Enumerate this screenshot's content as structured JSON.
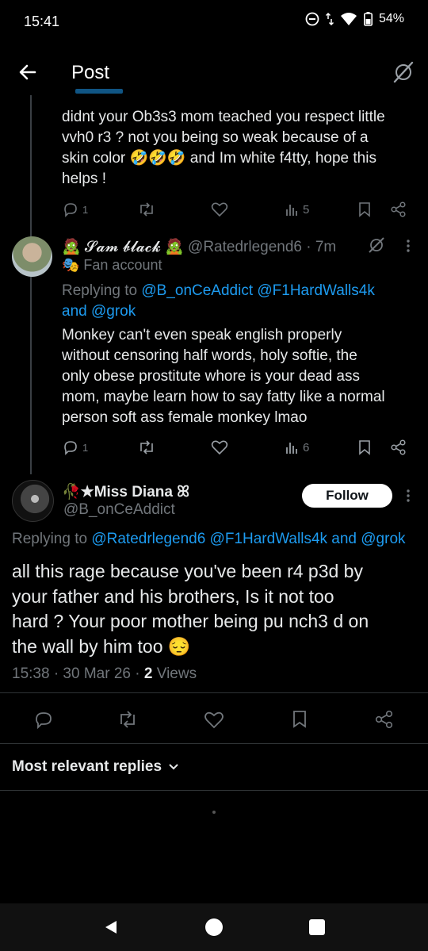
{
  "status": {
    "time": "15:41",
    "battery": "54%"
  },
  "header": {
    "title": "Post"
  },
  "tweet_top": {
    "text_lines": [
      "didnt your Ob3s3 mom teached you respect little",
      "vvh0 r3 ? not you being so weak because of a",
      "skin color 🤣🤣🤣 and Im white f4tty, hope this",
      "helps !"
    ],
    "reply_count": "1",
    "views": "5"
  },
  "tweet_reply": {
    "display_name": "🧟 𝓢𝓪𝓶 𝓫𝓵𝓪𝓬𝓴 🧟",
    "handle_time": "@Ratedrlegend6 · 7m",
    "fan_badge": "🎭 Fan account",
    "replying_prefix": "Replying to",
    "replying_to_1": "@B_onCeAddict @F1HardWalls4k",
    "replying_to_2": "and @grok",
    "text_lines": [
      "Monkey can't even speak english properly",
      "without censoring half words, holy softie, the",
      "only obese prostitute whore is your dead ass",
      "mom, maybe learn how to say fatty like a normal",
      "person soft ass female monkey lmao"
    ],
    "reply_count": "1",
    "views": "6"
  },
  "main_post": {
    "display_name": "🥀★Miss Diana ꕤ",
    "handle": "@B_onCeAddict",
    "follow_label": "Follow",
    "replying_prefix": "Replying to",
    "replying_to": "@Ratedrlegend6 @F1HardWalls4k and @grok",
    "text_lines": [
      "all this rage because you've been r4 p3d by",
      "your father and his brothers, Is it not too",
      "hard ? Your poor mother being pu nch3 d on",
      "the wall by him too 😔"
    ],
    "timestamp": "15:38 · 30 Mar 26 ·",
    "views_count": "2",
    "views_label": "Views"
  },
  "replies_sort": {
    "label": "Most relevant replies"
  },
  "colors": {
    "accent": "#1d9bf0",
    "muted": "#71767b",
    "text": "#e7e9ea",
    "divider": "#2f3336"
  }
}
